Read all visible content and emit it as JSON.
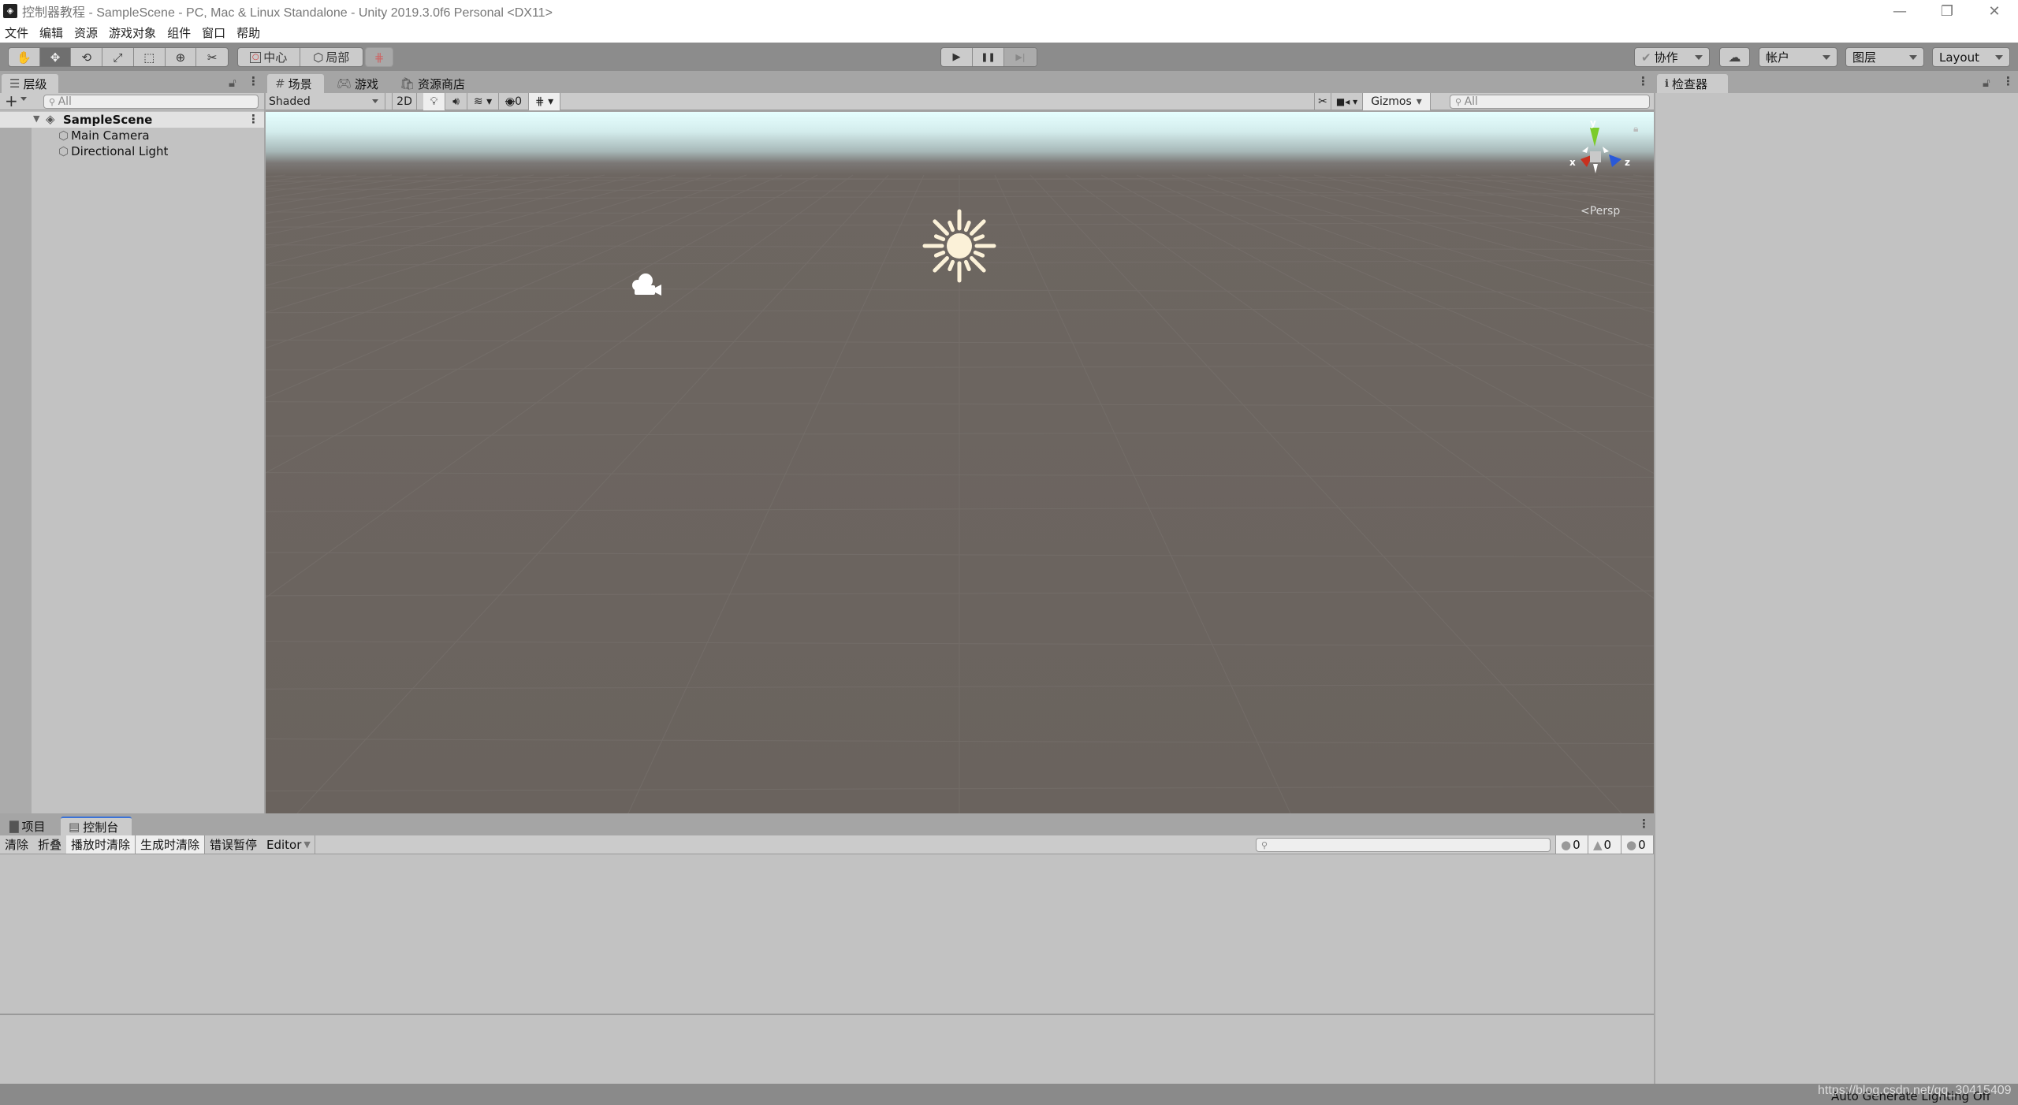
{
  "window": {
    "title": "控制器教程 - SampleScene - PC, Mac & Linux Standalone - Unity 2019.3.0f6 Personal <DX11>",
    "controls": {
      "minimize": "—",
      "restore": "❐",
      "close": "✕"
    }
  },
  "menu": [
    "文件",
    "编辑",
    "资源",
    "游戏对象",
    "组件",
    "窗口",
    "帮助"
  ],
  "toolbar": {
    "tools": [
      {
        "name": "hand-tool",
        "icon": "✋",
        "active": false
      },
      {
        "name": "move-tool",
        "icon": "✥",
        "active": true
      },
      {
        "name": "rotate-tool",
        "icon": "⟲",
        "active": false
      },
      {
        "name": "scale-tool",
        "icon": "⤢",
        "active": false
      },
      {
        "name": "rect-tool",
        "icon": "⬚",
        "active": false
      },
      {
        "name": "transform-tool",
        "icon": "⊕",
        "active": false
      },
      {
        "name": "custom-tool",
        "icon": "✂",
        "active": false
      }
    ],
    "pivot_label": "中心",
    "space_label": "局部",
    "snap_icon": "⋕",
    "play_icon": "▶",
    "pause_icon": "❚❚",
    "step_icon": "▶|",
    "collab_label": "协作",
    "cloud_icon": "☁",
    "account_label": "帐户",
    "layers_label": "图层",
    "layout_label": "Layout"
  },
  "hierarchy": {
    "tab_label": "层级",
    "add_label": "+",
    "search_placeholder": "All",
    "scene_name": "SampleScene",
    "items": [
      "Main Camera",
      "Directional Light"
    ]
  },
  "scene": {
    "tabs": [
      "场景",
      "游戏",
      "资源商店"
    ],
    "shading_mode": "Shaded",
    "mode_2d": "2D",
    "hidden_count": "0",
    "gizmos_label": "Gizmos",
    "search_placeholder": "All",
    "projection_label": "Persp",
    "axes": {
      "x": "x",
      "y": "y",
      "z": "z"
    },
    "axis_colors": {
      "x": "#c8301e",
      "y": "#7ccb2a",
      "z": "#2a59d8"
    }
  },
  "inspector": {
    "tab_label": "检查器"
  },
  "bottom": {
    "tabs": [
      "项目",
      "控制台"
    ],
    "buttons": [
      {
        "label": "清除",
        "on": false
      },
      {
        "label": "折叠",
        "on": false
      },
      {
        "label": "播放时清除",
        "on": true
      },
      {
        "label": "生成时清除",
        "on": true
      },
      {
        "label": "错误暂停",
        "on": false
      }
    ],
    "editor_dropdown": "Editor",
    "counts": {
      "info": "0",
      "warning": "0",
      "error": "0"
    }
  },
  "status": {
    "text": "Auto Generate Lighting Off",
    "watermark": "https://blog.csdn.net/qq_30415409"
  }
}
